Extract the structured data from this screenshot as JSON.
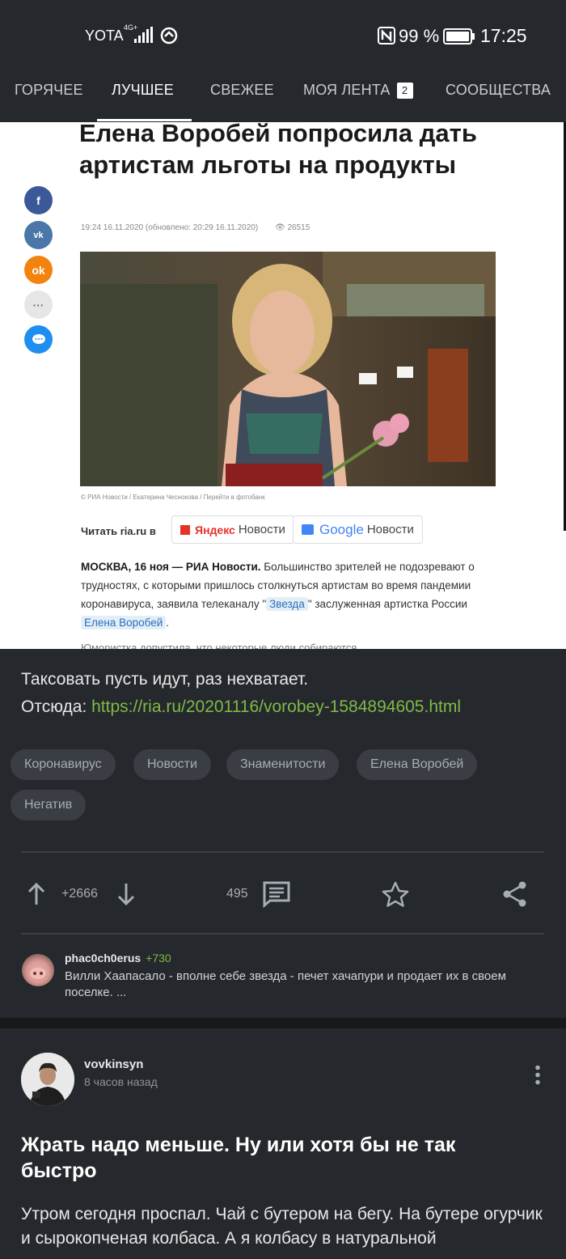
{
  "status_bar": {
    "carrier": "YOTA",
    "network": "4G+",
    "battery_percent": "99 %",
    "time": "17:25",
    "icons": [
      "signal-icon",
      "sync-icon",
      "nfc-icon",
      "battery-icon"
    ]
  },
  "tabs": [
    {
      "label": "ГОРЯЧЕЕ",
      "active": false
    },
    {
      "label": "ЛУЧШЕЕ",
      "active": true
    },
    {
      "label": "СВЕЖЕЕ",
      "active": false
    },
    {
      "label": "МОЯ ЛЕНТА",
      "badge": "2",
      "active": false
    },
    {
      "label": "СООБЩЕСТВА",
      "active": false
    }
  ],
  "article": {
    "title": "Елена Воробей попросила дать артистам льготы на продукты",
    "meta": "19:24 16.11.2020 (обновлено: 20:29 16.11.2020)",
    "views": "26515",
    "share_icons": [
      "facebook-icon",
      "vk-icon",
      "odnoklassniki-icon",
      "more-icon",
      "messenger-icon"
    ],
    "share_colors": [
      "#3b5998",
      "#4a76a8",
      "#f2830f",
      "#e6e6e6",
      "#1f8ef1"
    ],
    "photo_caption": "© РИА Новости / Екатерина Чеснокова / Перейти в фотобанк",
    "read_label": "Читать ria.ru в",
    "yandex_brand": "Яндекс",
    "yandex_suffix": "Новости",
    "google_brand": "Google",
    "google_suffix": "Новости",
    "lead_bold": "МОСКВА, 16 ноя — РИА Новости.",
    "lead_text_1": "Большинство зрителей не подозревают о трудностях, с которыми пришлось столкнуться артистам во время пандемии коронавируса, заявила телеканалу \"",
    "lead_link_1": "Звезда",
    "lead_text_2": "\" заслуженная артистка России",
    "lead_link_2": "Елена Воробей",
    "lead_text_3": ".",
    "cut_text": "Юмористка допустила, что некоторые люди собираются..."
  },
  "post": {
    "text_line1": "Таксовать пусть идут, раз нехватает.",
    "source_label": "Отсюда:",
    "source_url": "https://ria.ru/20201116/vorobey-1584894605.html",
    "tags": [
      "Коронавирус",
      "Новости",
      "Знаменитости",
      "Елена Воробей",
      "Негатив"
    ],
    "rating": "+2666",
    "comments": "495",
    "accent_color": "#7fba48"
  },
  "comment_preview": {
    "user": "phac0ch0erus",
    "rating": "+730",
    "text": "Вилли Хаапасало - вполне себе звезда - печет хачапури и продает их в своем поселке. ..."
  },
  "post2": {
    "user": "vovkinsyn",
    "time": "8 часов назад",
    "title": "Жрать надо меньше. Ну или хотя бы не так быстро",
    "text": "Утром сегодня проспал. Чай с бутером на бегу. На бутере огурчик и сырокопченая колбаса. А я колбасу  в натуральной"
  }
}
